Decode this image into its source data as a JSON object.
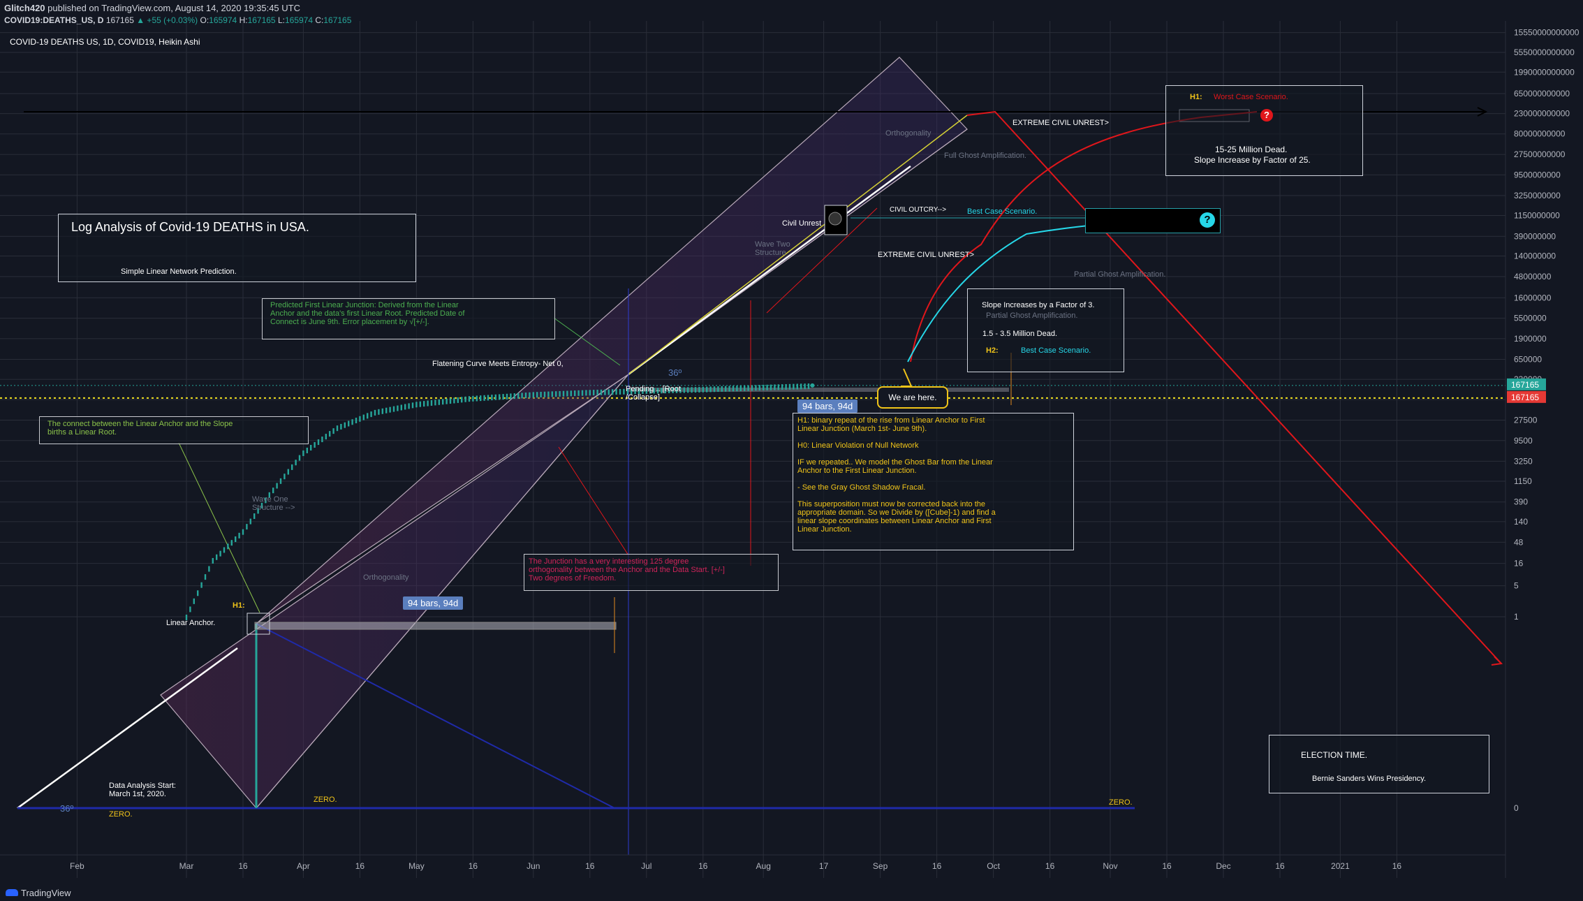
{
  "header": {
    "author": "Glitch420",
    "published": "published on TradingView.com, August 14, 2020 19:35:45 UTC",
    "symbol": "COVID19:DEATHS_US, D",
    "last": "167165",
    "change": "▲ +55 (+0.03%)",
    "o_label": "O:",
    "o": "165974",
    "h_label": "H:",
    "h": "167165",
    "l_label": "L:",
    "l": "165974",
    "c_label": "C:",
    "c": "167165"
  },
  "legend_title": "COVID-19 DEATHS US, 1D, COVID19, Heikin Ashi",
  "footer": "TradingView",
  "colors": {
    "bg": "#131722",
    "grid": "#2a2e39",
    "white_line": "#ffffff",
    "yellow_line": "#d4d035",
    "red": "#e0161b",
    "cyan": "#26d7e8",
    "blue": "#1f2aa8",
    "teal": "#26a69a",
    "green_text": "#4caf50",
    "pink_text": "#d0245a",
    "yellow_text": "#f0c419",
    "label_blue": "#5b7fbe"
  },
  "chart_data": {
    "type": "line",
    "y_scale": "log",
    "x_ticks": [
      "Feb",
      "Mar",
      "16",
      "Apr",
      "16",
      "May",
      "16",
      "Jun",
      "16",
      "Jul",
      "16",
      "Aug",
      "17",
      "Sep",
      "16",
      "Oct",
      "16",
      "Nov",
      "16",
      "Dec",
      "16",
      "2021",
      "16"
    ],
    "y_ticks": [
      "15550000000000",
      "5550000000000",
      "1990000000000",
      "650000000000",
      "230000000000",
      "80000000000",
      "27500000000",
      "9500000000",
      "3250000000",
      "1150000000",
      "390000000",
      "140000000",
      "48000000",
      "16000000",
      "5500000",
      "1900000",
      "650000",
      "230000",
      "80000",
      "27500",
      "9500",
      "3250",
      "1150",
      "390",
      "140",
      "48",
      "16",
      "5",
      "1",
      "0"
    ],
    "y_ticks_display": [
      "15550000000000",
      "5550000000000",
      "1990000000000",
      "650000000000",
      "230000000000",
      "80000000000",
      "27500000000",
      "9500000000",
      "3250000000",
      "1150000000",
      "390000000",
      "140000000",
      "48000000",
      "16000000",
      "5500000",
      "1900000",
      "650000",
      "230000",
      "80000",
      "27500",
      "9500",
      "3250",
      "1150",
      "390",
      "140",
      "48",
      "16",
      "5",
      "1"
    ],
    "price_labels": [
      {
        "value": "167165",
        "color": "#26a69a"
      },
      {
        "value": "167165",
        "color": "#e53935"
      }
    ],
    "series": [
      {
        "name": "",
        "points": [
          {
            "x": "2020-03-01",
            "y": 1
          },
          {
            "x": "2020-03-08",
            "y": 19
          },
          {
            "x": "2020-03-16",
            "y": 85
          },
          {
            "x": "2020-03-23",
            "y": 580
          },
          {
            "x": "2020-04-01",
            "y": 5100
          },
          {
            "x": "2020-04-10",
            "y": 18700
          },
          {
            "x": "2020-04-20",
            "y": 42000
          },
          {
            "x": "2020-05-01",
            "y": 64000
          },
          {
            "x": "2020-05-15",
            "y": 86000
          },
          {
            "x": "2020-06-01",
            "y": 106000
          },
          {
            "x": "2020-06-15",
            "y": 118000
          },
          {
            "x": "2020-07-01",
            "y": 130000
          },
          {
            "x": "2020-07-15",
            "y": 139000
          },
          {
            "x": "2020-08-01",
            "y": 155000
          },
          {
            "x": "2020-08-14",
            "y": 167165
          }
        ]
      }
    ]
  },
  "annotations": {
    "title_box": {
      "title": "Log Analysis of Covid-19 DEATHS in USA.",
      "subtitle": "Simple Linear Network Prediction."
    },
    "green_box": "Predicted First Linear Junction: Derived from the Linear\nAnchor and the data's first Linear Root. Predicted Date of\nConnect is June 9th. Error placement by √[+/-].",
    "linear_root_box": "The connect between the Linear Anchor and the Slope\nbirths a Linear Root.",
    "pink_box": "The Junction has a very interesting 125 degree\northogonality between the Anchor and the Data Start. [+/-]\nTwo degrees of Freedom.",
    "h1_box": {
      "label": "H1:",
      "title": "Worst Case Scenario.",
      "line1": "15-25 Million Dead.",
      "line2": "Slope Increase by Factor of 25."
    },
    "h2_box": {
      "line1": "Slope Increases by a Factor of 3.",
      "ghost": "Partial Ghost Amplification.",
      "line2": "1.5 - 3.5 Million Dead.",
      "label": "H2:",
      "title": "Best Case Scenario."
    },
    "yellow_box": "H1: binary repeat of the rise from Linear Anchor to First\nLinear Junction (March 1st- June 9th).\n\nH0: Linear Violation of Null Network\n\nIF we repeated.. We model the Ghost Bar from the Linear\nAnchor to the First Linear Junction.\n\n- See the Gray Ghost Shadow Fracal.\n\nThis superposition must now be corrected back into the\nappropriate domain. So we Divide by ([Cube]-1) and find a\nlinear slope coordinates between Linear Anchor and First\nLinear Junction.",
    "election_box": {
      "title": "ELECTION TIME.",
      "body": "Bernie Sanders Wins Presidency."
    },
    "extreme_civil_unrest_1": "EXTREME CIVIL UNREST>",
    "extreme_civil_unrest_2": "EXTREME CIVIL UNREST>",
    "civil_outcry": "CIVIL OUTCRY-->",
    "best_case_top": "Best Case Scenario.",
    "civil_unrest": "Civil Unrest",
    "orthogonality_top": "Orthogonality",
    "orthogonality_bottom": "Orthogonality",
    "full_ghost": "Full Ghost Amplification.",
    "partial_ghost": "Partial Ghost Amplification.",
    "wave_two": "Wave Two\nStructure",
    "wave_one": "Wave One\nStructure -->",
    "flatening": "Flatening Curve Meets Entropy- Net 0,",
    "pending": "Pending .. [Root\n/Collapse]",
    "angle_36_a": "36º",
    "angle_36_b": "36º",
    "we_are_here": "We are here.",
    "bars_label_1": "94 bars, 94d",
    "bars_label_2": "94 bars, 94d",
    "h1_small": "H1:",
    "linear_anchor": "Linear Anchor.",
    "data_start": "Data Analysis Start:\nMarch 1st, 2020.",
    "zero_1": "ZERO.",
    "zero_2": "ZERO.",
    "zero_3": "ZERO.",
    "question": "?"
  }
}
